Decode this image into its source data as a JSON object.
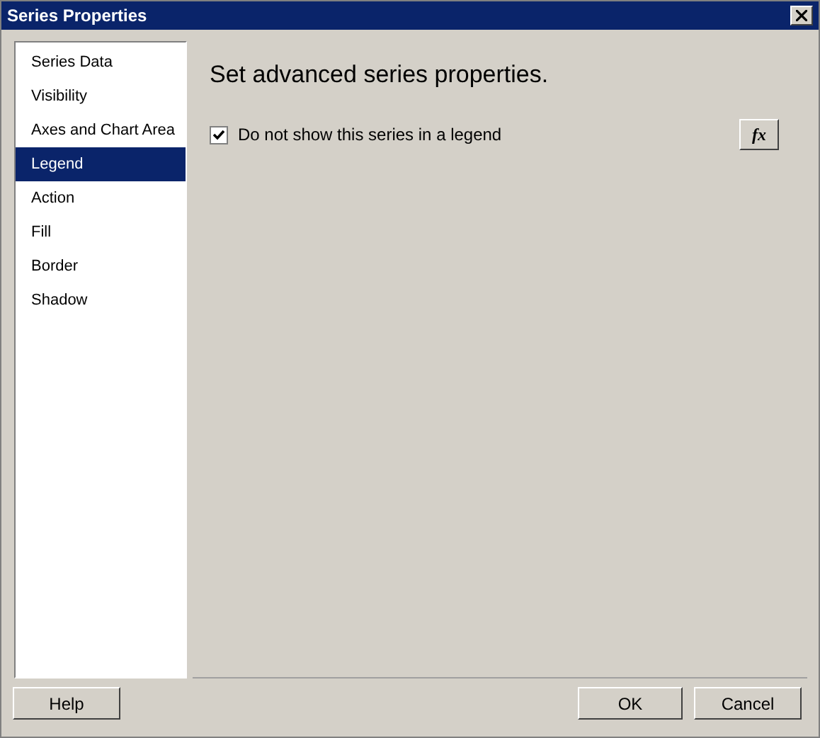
{
  "window": {
    "title": "Series Properties"
  },
  "sidebar": {
    "items": [
      {
        "label": "Series Data",
        "selected": false
      },
      {
        "label": "Visibility",
        "selected": false
      },
      {
        "label": "Axes and Chart Area",
        "selected": false
      },
      {
        "label": "Legend",
        "selected": true
      },
      {
        "label": "Action",
        "selected": false
      },
      {
        "label": "Fill",
        "selected": false
      },
      {
        "label": "Border",
        "selected": false
      },
      {
        "label": "Shadow",
        "selected": false
      }
    ]
  },
  "content": {
    "heading": "Set advanced series properties.",
    "option": {
      "label": "Do not show this series in a legend",
      "checked": true
    },
    "expression_button": "fx"
  },
  "buttons": {
    "help": "Help",
    "ok": "OK",
    "cancel": "Cancel"
  }
}
